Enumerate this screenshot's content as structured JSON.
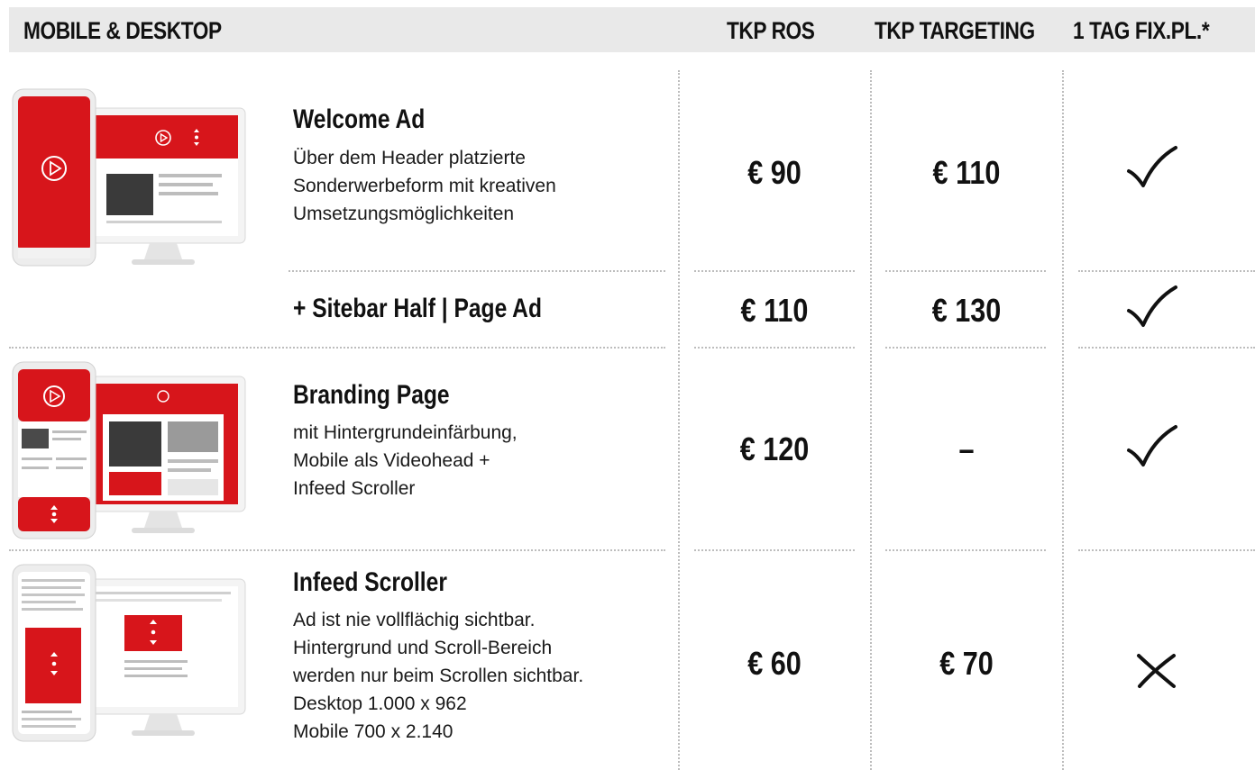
{
  "header": {
    "section": "MOBILE & DESKTOP",
    "col_ros": "TKP ROS",
    "col_targeting": "TKP TARGETING",
    "col_fix": "1 TAG FIX.PL.*"
  },
  "rows": [
    {
      "title": "Welcome Ad",
      "desc": [
        "Über dem Header platzierte",
        "Sonderwerbeform mit kreativen",
        "Umsetzungsmöglichkeiten"
      ],
      "ros": "€ 90",
      "targeting": "€ 110",
      "fix": "check"
    },
    {
      "title": "+ Sitebar Half | Page Ad",
      "desc": [],
      "ros": "€ 110",
      "targeting": "€ 130",
      "fix": "check"
    },
    {
      "title": "Branding Page",
      "desc": [
        "mit Hintergrundeinfärbung,",
        "Mobile als Videohead +",
        "Infeed Scroller"
      ],
      "ros": "€ 120",
      "targeting": "–",
      "fix": "check"
    },
    {
      "title": "Infeed Scroller",
      "desc": [
        "Ad ist nie vollflächig sichtbar.",
        "Hintergrund und Scroll-Bereich",
        "werden nur beim Scrollen sichtbar.",
        "Desktop 1.000 x 962",
        "Mobile 700 x 2.140"
      ],
      "ros": "€ 60",
      "targeting": "€ 70",
      "fix": "cross"
    }
  ],
  "icons": {
    "check": "check-icon",
    "cross": "cross-icon"
  },
  "colors": {
    "brand_red": "#d7151b",
    "header_bg": "#e9e9e9",
    "divider": "#bdbdbd"
  }
}
